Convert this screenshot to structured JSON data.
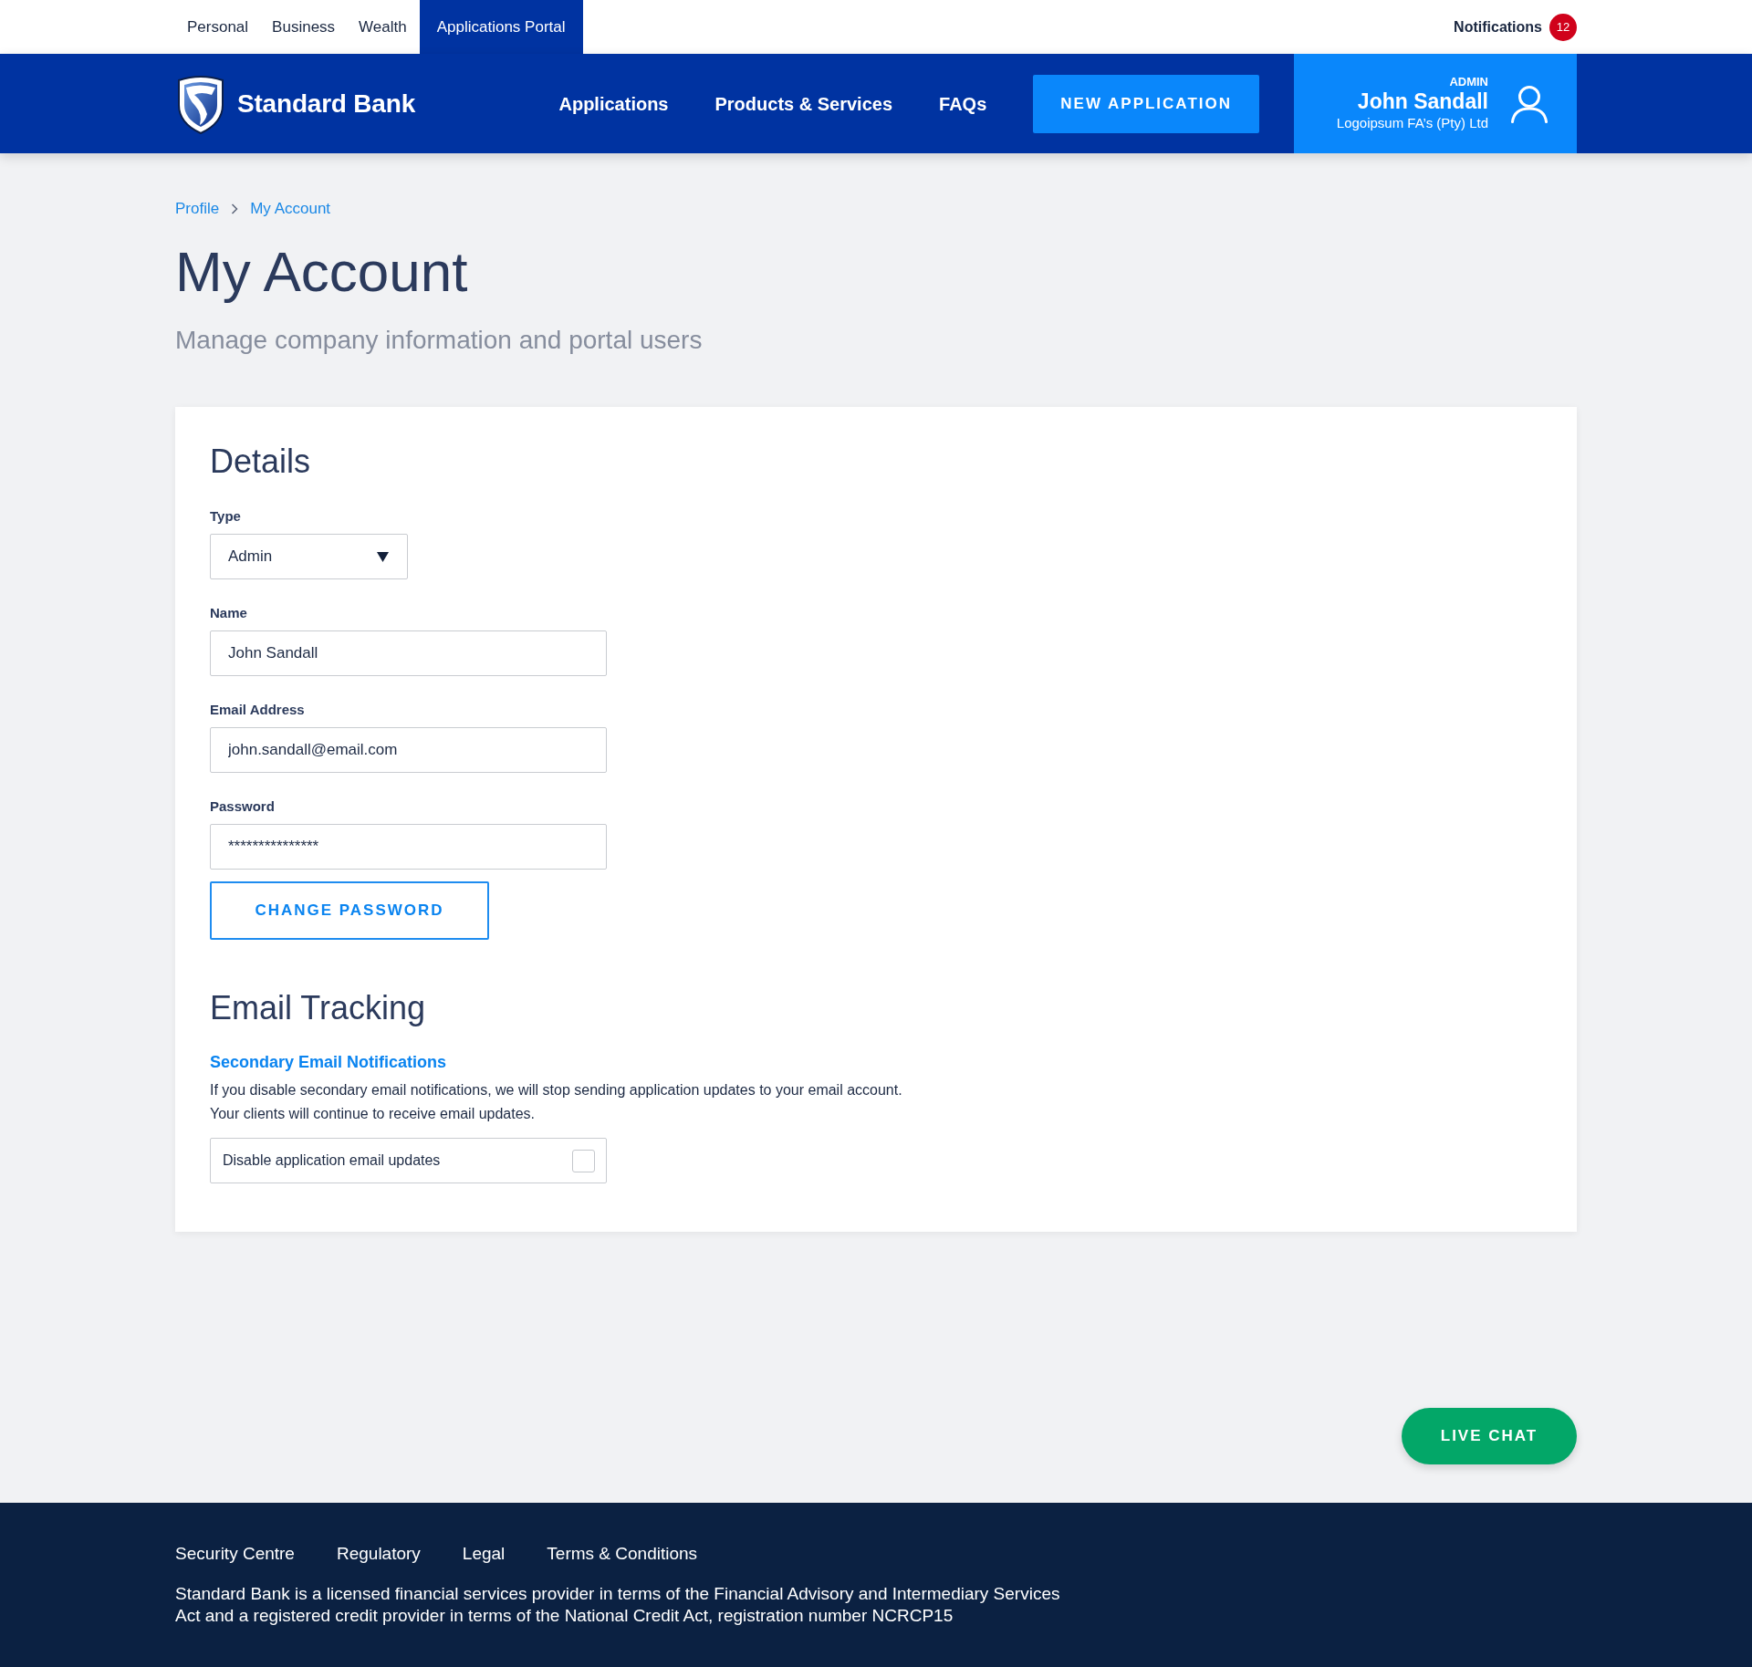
{
  "top_bar": {
    "links": [
      {
        "label": "Personal",
        "selected": false
      },
      {
        "label": "Business",
        "selected": false
      },
      {
        "label": "Wealth",
        "selected": false
      },
      {
        "label": "Applications Portal",
        "selected": true
      }
    ],
    "notifications": {
      "label": "Notifications",
      "count": "12"
    }
  },
  "navbar": {
    "brand": "Standard Bank",
    "links": [
      "Applications",
      "Products & Services",
      "FAQs"
    ],
    "cta": "NEW APPLICATION",
    "user": {
      "role": "ADMIN",
      "name": "John Sandall",
      "company": "Logoipsum FA’s (Pty) Ltd"
    }
  },
  "breadcrumb": [
    {
      "label": "Profile"
    },
    {
      "label": "My Account"
    }
  ],
  "page": {
    "title": "My Account",
    "subtitle": "Manage company information and portal users"
  },
  "details": {
    "title": "Details",
    "fields": [
      {
        "kind": "select",
        "label": "Type",
        "value": "Admin"
      },
      {
        "kind": "text",
        "label": "Name",
        "value": "John Sandall"
      },
      {
        "kind": "text",
        "label": "Email Address",
        "value": "john.sandall@email.com"
      },
      {
        "kind": "text",
        "label": "Password",
        "value": "***************"
      }
    ],
    "button": "CHANGE PASSWORD"
  },
  "email_tracking": {
    "title": "Email Tracking",
    "subtitle": "Secondary Email Notifications",
    "description": [
      "If you disable secondary email notifications, we will stop sending application updates to your email account.",
      "Your clients will continue to receive email updates."
    ],
    "option": {
      "label": "Disable application email updates",
      "checked": false
    }
  },
  "live_chat": "LIVE CHAT",
  "footer": {
    "links": [
      "Security Centre",
      "Regulatory",
      "Legal",
      "Terms & Conditions"
    ],
    "disclaimer": [
      "Standard Bank is a licensed financial services provider in terms of the Financial Advisory and Intermediary Services",
      "Act and a registered credit provider in terms of the National Credit Act, registration number NCRCP15"
    ]
  }
}
